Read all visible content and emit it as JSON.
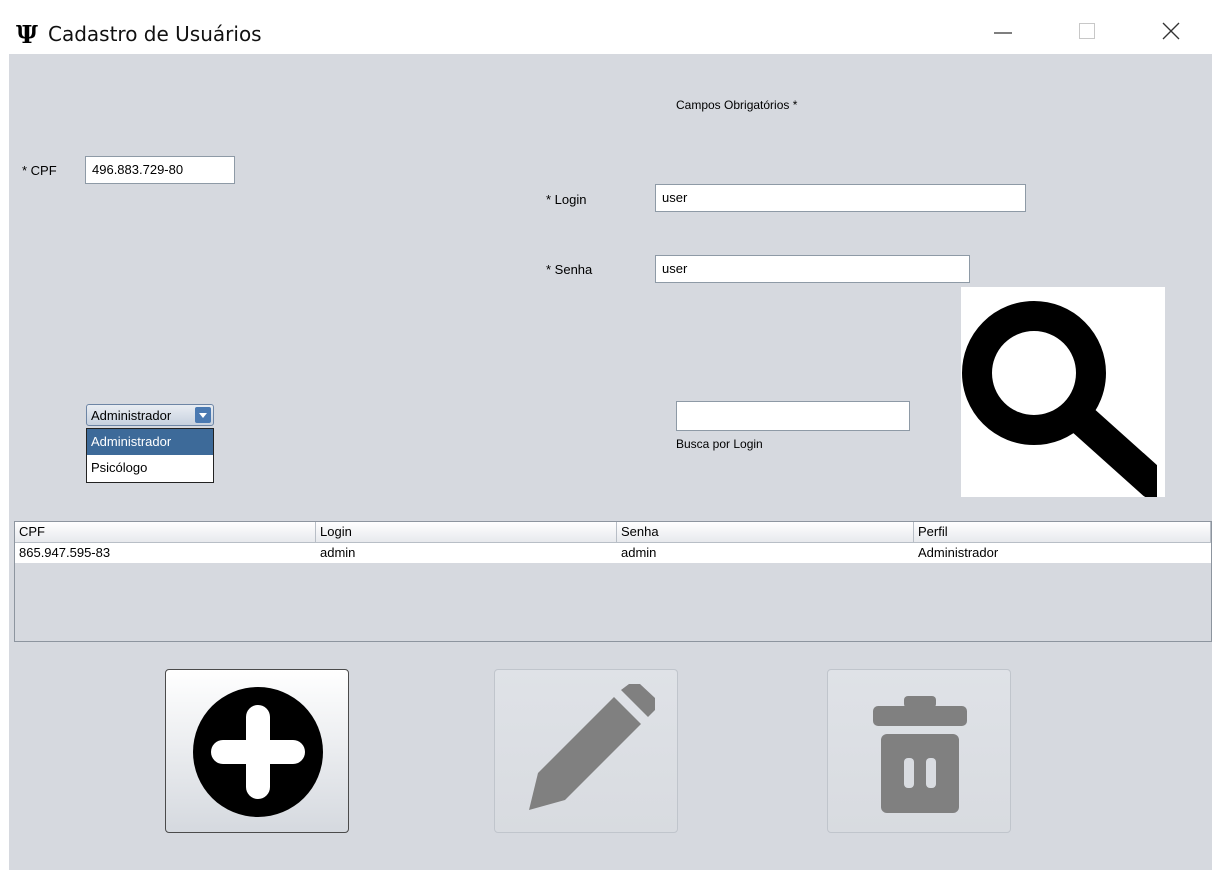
{
  "window": {
    "title": "Cadastro de Usuários",
    "icon_glyph": "Ψ",
    "controls": [
      "minimize-icon",
      "maximize-icon",
      "close-icon"
    ]
  },
  "form": {
    "required_note": "Campos Obrigatórios *",
    "cpf": {
      "label": "* CPF",
      "value": "496.883.729-80"
    },
    "login": {
      "label": "* Login",
      "value": "user"
    },
    "senha": {
      "label": "* Senha",
      "value": "user"
    },
    "profile_combo": {
      "selected": "Administrador",
      "options": [
        "Administrador",
        "Psicólogo"
      ],
      "highlighted_index": 0
    },
    "search": {
      "value": "",
      "label": "Busca por Login",
      "icon": "magnifier-icon"
    }
  },
  "table": {
    "columns": [
      "CPF",
      "Login",
      "Senha",
      "Perfil"
    ],
    "rows": [
      [
        "865.947.595-83",
        "admin",
        "admin",
        "Administrador"
      ]
    ]
  },
  "actions": [
    {
      "name": "add",
      "icon": "plus-circle-icon",
      "enabled": true
    },
    {
      "name": "edit",
      "icon": "pencil-icon",
      "enabled": false
    },
    {
      "name": "delete",
      "icon": "trash-icon",
      "enabled": false
    }
  ],
  "colors": {
    "panel_bg": "#d6d9df",
    "selection_blue": "#3d6a99",
    "disabled_icon": "#808080"
  }
}
